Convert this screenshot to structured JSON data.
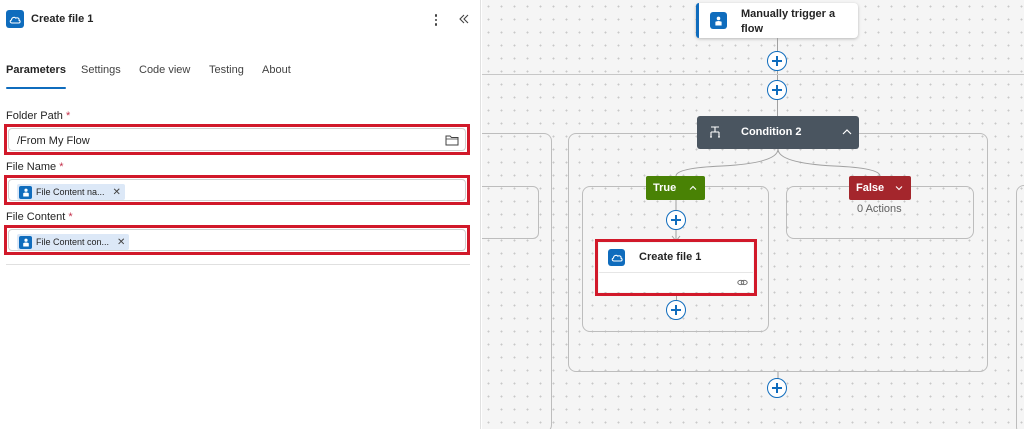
{
  "panel": {
    "title": "Create file 1",
    "tabs": [
      "Parameters",
      "Settings",
      "Code view",
      "Testing",
      "About"
    ],
    "active_tab": "Parameters",
    "fields": {
      "folder_path": {
        "label": "Folder Path",
        "value": "/From My Flow"
      },
      "file_name": {
        "label": "File Name",
        "token": "File Content na..."
      },
      "file_content": {
        "label": "File Content",
        "token": "File Content con..."
      }
    },
    "required_mark": "*"
  },
  "canvas": {
    "trigger": {
      "title_line1": "Manually trigger a",
      "title_line2": "flow"
    },
    "condition": {
      "title": "Condition 2"
    },
    "true_branch": {
      "label": "True"
    },
    "false_branch": {
      "label": "False",
      "actions": "0 Actions"
    },
    "action": {
      "title": "Create file 1"
    }
  },
  "colors": {
    "accent": "#0f6cbd",
    "highlight": "#d1192a",
    "true": "#498205",
    "false": "#a4262c",
    "condition": "#4a5560"
  }
}
